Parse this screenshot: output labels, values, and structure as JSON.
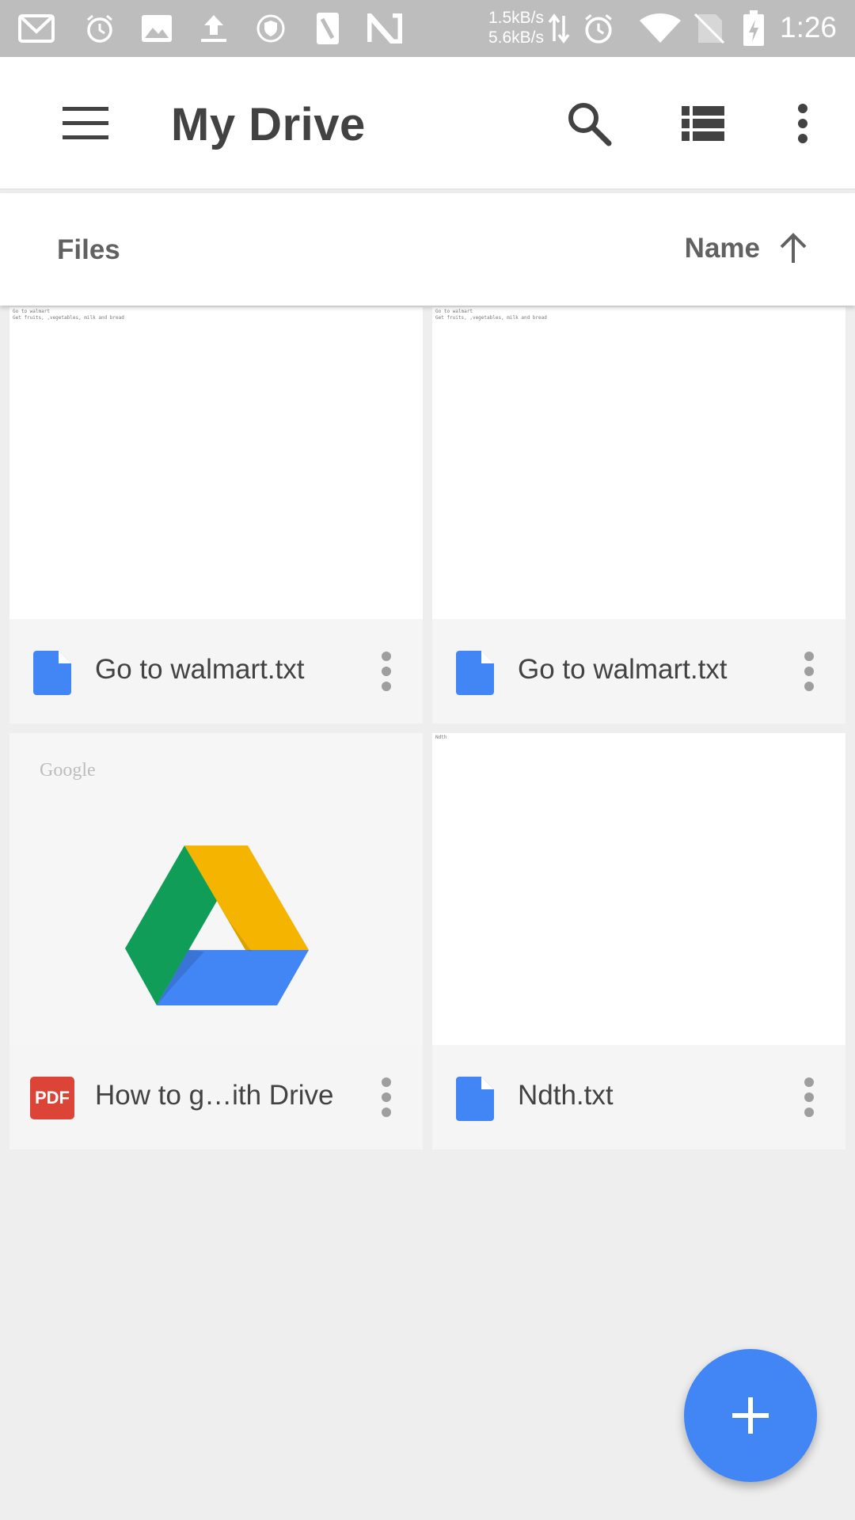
{
  "status_bar": {
    "speed_up": "1.5kB/s",
    "speed_down": "5.6kB/s",
    "time": "1:26",
    "icons": [
      "gmail-icon",
      "alarm-icon",
      "image-icon",
      "upload-icon",
      "vpn-shield-icon",
      "sim-icon",
      "n-icon",
      "data-arrows-icon",
      "alarm-icon",
      "wifi-icon",
      "no-sim-icon",
      "battery-charging-icon"
    ]
  },
  "app_bar": {
    "title": "My Drive",
    "icons": [
      "menu-icon",
      "search-icon",
      "list-view-icon",
      "more-vert-icon"
    ]
  },
  "sort_bar": {
    "section": "Files",
    "sort_by": "Name",
    "sort_direction_icon": "arrow-up-icon"
  },
  "files": [
    {
      "name": "Go to walmart.txt",
      "type_icon": "doc-icon",
      "preview_text": "Go to walmart\nGet fruits, ,vegetables, milk and bread"
    },
    {
      "name": "Go to walmart.txt",
      "type_icon": "doc-icon",
      "preview_text": "Go to walmart\nGet fruits, ,vegetables, milk and bread"
    },
    {
      "name": "How to g…ith Drive",
      "type_icon": "pdf-icon",
      "pdf_label": "PDF",
      "watermark": "Google"
    },
    {
      "name": "Ndth.txt",
      "type_icon": "doc-icon",
      "preview_text": "Ndth"
    }
  ],
  "fab": {
    "icon": "plus-icon"
  },
  "colors": {
    "accent": "#4285f4",
    "pdf_red": "#db4437",
    "drive_green": "#0f9d58",
    "drive_yellow": "#f4b400",
    "drive_blue": "#4285f4"
  }
}
